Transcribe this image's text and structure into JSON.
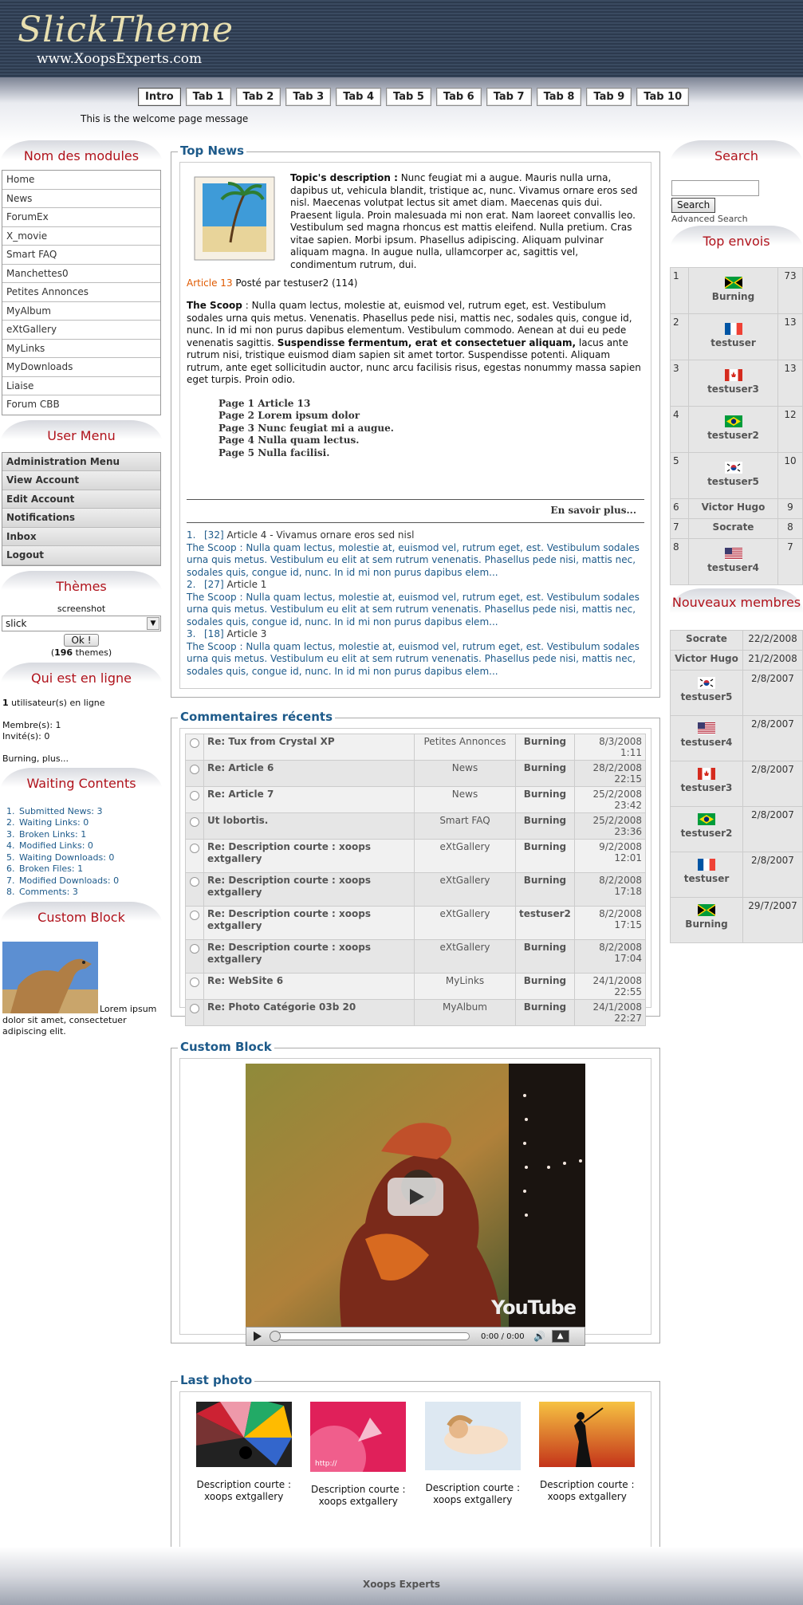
{
  "header": {
    "logo_title": "SlickTheme",
    "logo_url": "www.XoopsExperts.com"
  },
  "tabs": [
    "Intro",
    "Tab 1",
    "Tab 2",
    "Tab 3",
    "Tab 4",
    "Tab 5",
    "Tab 6",
    "Tab 7",
    "Tab 8",
    "Tab 9",
    "Tab 10"
  ],
  "welcome": "This is the welcome page message",
  "left": {
    "modules_title": "Nom des modules",
    "modules": [
      "Home",
      "News",
      "ForumEx",
      "X_movie",
      "Smart FAQ",
      "Manchettes0",
      "Petites Annonces",
      "MyAlbum",
      "eXtGallery",
      "MyLinks",
      "MyDownloads",
      "Liaise",
      "Forum CBB"
    ],
    "usermenu_title": "User Menu",
    "usermenu": [
      "Administration Menu",
      "View Account",
      "Edit Account",
      "Notifications",
      "Inbox",
      "Logout"
    ],
    "themes_title": "Thèmes",
    "themes_screenshot": "screenshot",
    "themes_selected": "slick",
    "themes_ok": "Ok !",
    "themes_count": "196",
    "themes_word": "themes",
    "online_title": "Qui est en ligne",
    "online_count": "1",
    "online_text": "utilisateur(s) en ligne",
    "online_members": "Membre(s): 1",
    "online_guests": "Invité(s): 0",
    "online_more": "Burning, plus...",
    "waiting_title": "Waiting Contents",
    "waiting": [
      {
        "label": "Submitted News:",
        "value": "3"
      },
      {
        "label": "Waiting Links:",
        "value": "0"
      },
      {
        "label": "Broken Links:",
        "value": "1"
      },
      {
        "label": "Modified Links:",
        "value": "0"
      },
      {
        "label": "Waiting Downloads:",
        "value": "0"
      },
      {
        "label": "Broken Files:",
        "value": "1"
      },
      {
        "label": "Modified Downloads:",
        "value": "0"
      },
      {
        "label": "Comments:",
        "value": "3"
      }
    ],
    "custom_title": "Custom Block",
    "custom_text": "Lorem ipsum dolor sit amet, consectetuer adipiscing elit."
  },
  "center": {
    "topnews_title": "Top News",
    "topic_desc_label": "Topic's description :",
    "topic_desc": "Nunc feugiat mi a augue. Mauris nulla urna, dapibus ut, vehicula blandit, tristique ac, nunc. Vivamus ornare eros sed nisl. Maecenas volutpat lectus sit amet diam. Maecenas quis dui. Praesent ligula. Proin malesuada mi non erat. Nam laoreet convallis leo. Vestibulum sed magna rhoncus est mattis eleifend. Nulla pretium. Cras vitae sapien. Morbi ipsum. Phasellus adipiscing. Aliquam pulvinar aliquam magna. In augue nulla, ullamcorper ac, sagittis vel, condimentum rutrum, dui.",
    "article_link": "Article 13",
    "article_meta": "Posté par testuser2 (114)",
    "scoop_label": "The Scoop",
    "scoop_text1": ": Nulla quam lectus, molestie at, euismod vel, rutrum eget, est. Vestibulum sodales urna quis metus. Venenatis. Phasellus pede nisi, mattis nec, sodales quis, congue id, nunc. In id mi non purus dapibus elementum. Vestibulum commodo. Aenean at dui eu pede venenatis sagittis.",
    "scoop_bold": "Suspendisse fermentum, erat et consectetuer aliquam,",
    "scoop_text2": "lacus ante rutrum nisi, tristique euismod diam sapien sit amet tortor. Suspendisse potenti. Aliquam rutrum, ante eget sollicitudin auctor, nunc arcu facilisis risus, egestas nonummy massa sapien eget turpis. Proin odio.",
    "pages": [
      "Page 1 Article 13",
      "Page 2 Lorem ipsum dolor",
      "Page 3 Nunc feugiat mi a augue.",
      "Page 4 Nulla quam lectus.",
      "Page 5 Nulla facilisi."
    ],
    "more": "En savoir plus...",
    "news_list": [
      {
        "num": "1.",
        "id": "[32]",
        "title": "Article 4 - Vivamus ornare eros sed nisl",
        "text": "The Scoop : Nulla quam lectus, molestie at, euismod vel, rutrum eget, est. Vestibulum sodales urna quis metus. Vestibulum eu elit at sem rutrum venenatis. Phasellus pede nisi, mattis nec, sodales quis, congue id, nunc. In id mi non purus dapibus elem..."
      },
      {
        "num": "2.",
        "id": "[27]",
        "title": "Article 1",
        "text": "The Scoop : Nulla quam lectus, molestie at, euismod vel, rutrum eget, est. Vestibulum sodales urna quis metus. Vestibulum eu elit at sem rutrum venenatis. Phasellus pede nisi, mattis nec, sodales quis, congue id, nunc. In id mi non purus dapibus elem..."
      },
      {
        "num": "3.",
        "id": "[18]",
        "title": "Article 3",
        "text": "The Scoop : Nulla quam lectus, molestie at, euismod vel, rutrum eget, est. Vestibulum sodales urna quis metus. Vestibulum eu elit at sem rutrum venenatis. Phasellus pede nisi, mattis nec, sodales quis, congue id, nunc. In id mi non purus dapibus elem..."
      }
    ],
    "comments_title": "Commentaires récents",
    "comments": [
      {
        "title": "Re: Tux from Crystal XP",
        "module": "Petites Annonces",
        "user": "Burning",
        "date": "8/3/2008 1:11"
      },
      {
        "title": "Re: Article 6",
        "module": "News",
        "user": "Burning",
        "date": "28/2/2008 22:15"
      },
      {
        "title": "Re: Article 7",
        "module": "News",
        "user": "Burning",
        "date": "25/2/2008 23:42"
      },
      {
        "title": "Ut lobortis.",
        "module": "Smart FAQ",
        "user": "Burning",
        "date": "25/2/2008 23:36"
      },
      {
        "title": "Re: Description courte : xoops extgallery",
        "module": "eXtGallery",
        "user": "Burning",
        "date": "9/2/2008 12:01"
      },
      {
        "title": "Re: Description courte : xoops extgallery",
        "module": "eXtGallery",
        "user": "Burning",
        "date": "8/2/2008 17:18"
      },
      {
        "title": "Re: Description courte : xoops extgallery",
        "module": "eXtGallery",
        "user": "testuser2",
        "date": "8/2/2008 17:15"
      },
      {
        "title": "Re: Description courte : xoops extgallery",
        "module": "eXtGallery",
        "user": "Burning",
        "date": "8/2/2008 17:04"
      },
      {
        "title": "Re: WebSite 6",
        "module": "MyLinks",
        "user": "Burning",
        "date": "24/1/2008 22:55"
      },
      {
        "title": "Re: Photo Catégorie 03b 20",
        "module": "MyAlbum",
        "user": "Burning",
        "date": "24/1/2008 22:27"
      }
    ],
    "custom_title": "Custom Block",
    "video_time": "0:00 / 0:00",
    "video_brand": "YouTube",
    "lastphoto_title": "Last photo",
    "photos": [
      "Description courte : xoops extgallery",
      "Description courte : xoops extgallery",
      "Description courte : xoops extgallery",
      "Description courte : xoops extgallery"
    ]
  },
  "right": {
    "search_title": "Search",
    "search_button": "Search",
    "advanced": "Advanced Search",
    "top_title": "Top envois",
    "top": [
      {
        "rank": "1",
        "user": "Burning",
        "count": "73",
        "flag": "jamaica"
      },
      {
        "rank": "2",
        "user": "testuser",
        "count": "13",
        "flag": "france"
      },
      {
        "rank": "3",
        "user": "testuser3",
        "count": "13",
        "flag": "canada"
      },
      {
        "rank": "4",
        "user": "testuser2",
        "count": "12",
        "flag": "brazil"
      },
      {
        "rank": "5",
        "user": "testuser5",
        "count": "10",
        "flag": "korea"
      },
      {
        "rank": "6",
        "user": "Victor Hugo",
        "count": "9",
        "flag": ""
      },
      {
        "rank": "7",
        "user": "Socrate",
        "count": "8",
        "flag": ""
      },
      {
        "rank": "8",
        "user": "testuser4",
        "count": "7",
        "flag": "usa"
      }
    ],
    "new_title": "Nouveaux membres",
    "new_members": [
      {
        "user": "Socrate",
        "date": "22/2/2008",
        "flag": ""
      },
      {
        "user": "Victor Hugo",
        "date": "21/2/2008",
        "flag": ""
      },
      {
        "user": "testuser5",
        "date": "2/8/2007",
        "flag": "korea"
      },
      {
        "user": "testuser4",
        "date": "2/8/2007",
        "flag": "usa"
      },
      {
        "user": "testuser3",
        "date": "2/8/2007",
        "flag": "canada"
      },
      {
        "user": "testuser2",
        "date": "2/8/2007",
        "flag": "brazil"
      },
      {
        "user": "testuser",
        "date": "2/8/2007",
        "flag": "france"
      },
      {
        "user": "Burning",
        "date": "29/7/2007",
        "flag": "jamaica"
      }
    ]
  },
  "footer": "Xoops Experts"
}
